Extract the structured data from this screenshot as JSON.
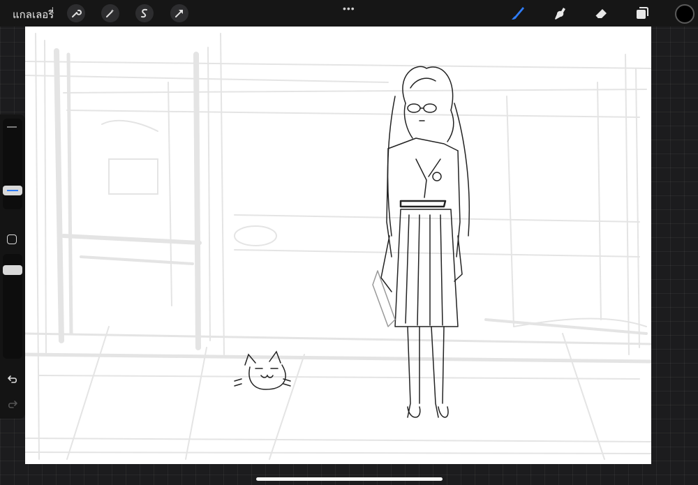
{
  "topbar": {
    "gallery_label": "แกลเลอรี่",
    "left_tools": [
      {
        "name": "wrench-icon"
      },
      {
        "name": "magic-wand-icon"
      },
      {
        "name": "selection-icon"
      },
      {
        "name": "transform-arrow-icon"
      }
    ],
    "more_dots": "•••",
    "right_tools": [
      {
        "name": "brush-icon",
        "active": true
      },
      {
        "name": "smudge-icon",
        "active": false
      },
      {
        "name": "eraser-icon",
        "active": false
      },
      {
        "name": "layers-icon",
        "active": false
      }
    ],
    "current_color": "#000000"
  },
  "colors": {
    "accent": "#2f7cf6",
    "topbar_bg": "#161616",
    "workspace_bg": "#1c1c1e",
    "canvas_bg": "#ffffff",
    "sketch_stroke": "#222222",
    "guide_stroke": "#e6e6e6"
  },
  "sidebar": {
    "brush_size_icon": "brush-size-slider",
    "modify_icon": "square-modify-icon",
    "opacity_icon": "opacity-slider",
    "undo_icon": "undo-arrow-icon",
    "redo_icon": "redo-arrow-icon"
  }
}
